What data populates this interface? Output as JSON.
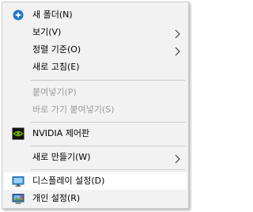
{
  "context_menu": {
    "items": [
      {
        "label": "새 폴더(N)",
        "icon": "new-folder-icon"
      },
      {
        "label": "보기(V)",
        "submenu": true
      },
      {
        "label": "정렬 기준(O)",
        "submenu": true
      },
      {
        "label": "새로 고침(E)"
      },
      {
        "label": "붙여넣기(P)",
        "disabled": true
      },
      {
        "label": "바로 가기 붙여넣기(S)",
        "disabled": true
      },
      {
        "label": "NVIDIA 제어판",
        "icon": "nvidia-icon"
      },
      {
        "label": "새로 만들기(W)",
        "submenu": true
      },
      {
        "label": "디스플레이 설정(D)",
        "icon": "display-icon",
        "hovered": true
      },
      {
        "label": "개인 설정(R)",
        "icon": "personalize-icon"
      }
    ]
  }
}
